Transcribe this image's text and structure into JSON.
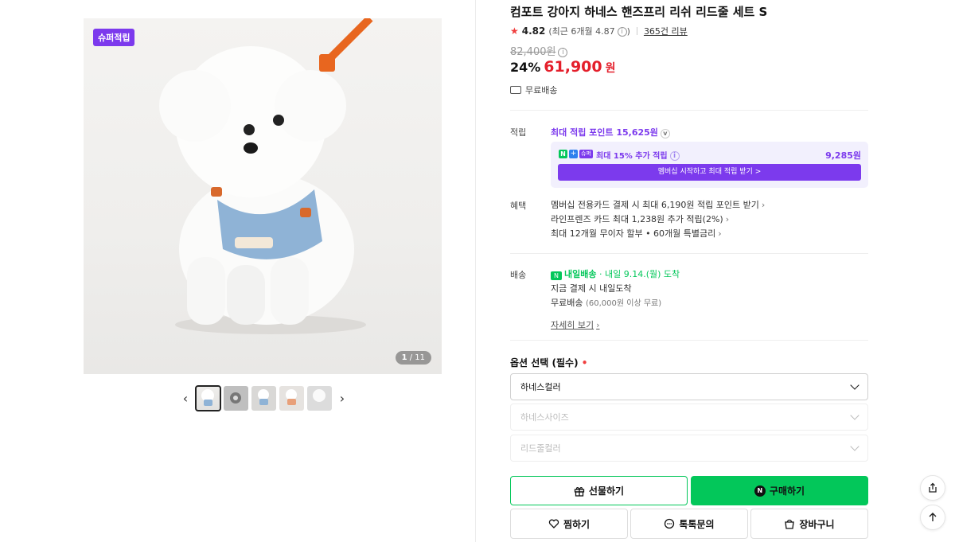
{
  "gallery": {
    "badge": "슈퍼적립",
    "counter_current": "1",
    "counter_total": "/ 11",
    "prev_label": "‹",
    "next_label": "›",
    "thumb_count": 5
  },
  "product": {
    "title": "컴포트 강아지 하네스 핸즈프리 리쉬 리드줄 세트 S",
    "rating_score": "4.82",
    "rating_recent": "(최근 6개월 4.87",
    "rating_recent_close": ")",
    "review_link": "365건 리뷰",
    "original_price": "82,400원",
    "discount": "24%",
    "sale_price": "61,900",
    "sale_unit": "원",
    "shipping": "무료배송"
  },
  "points": {
    "label": "적립",
    "max_text": "최대 적립 포인트 15,625원",
    "box_text": "최대 15% 추가 적립",
    "box_amount": "9,285원",
    "box_button": "멤버십 시작하고 최대 적립 받기 >",
    "badge_n": "N",
    "badge_plus": "+",
    "badge_super": "슈퍼"
  },
  "benefits": {
    "label": "혜택",
    "lines": [
      "멤버십 전용카드 결제 시 최대 6,190원 적립 포인트 받기",
      "라인프렌즈 카드 최대 1,238원 추가 적립(2%)",
      "최대 12개월 무이자 할부 • 60개월 특별금리"
    ]
  },
  "delivery": {
    "label": "배송",
    "badge": "N",
    "tomorrow": "내일배송",
    "eta": "· 내일 9.14.(월) 도착",
    "pay_note": "지금 결제 시 내일도착",
    "free": "무료배송",
    "free_note": "(60,000원 이상 무료)",
    "detail_link": "자세히 보기"
  },
  "options": {
    "title": "옵션 선택 (필수)",
    "required_mark": "•",
    "selects": [
      "하네스컬러",
      "하네스사이즈",
      "리드줄컬러"
    ]
  },
  "actions": {
    "gift": "선물하기",
    "buy": "구매하기",
    "buy_badge": "N",
    "wish": "찜하기",
    "talk": "톡톡문의",
    "cart": "장바구니"
  },
  "colors": {
    "accent_purple": "#7c3aed",
    "naver_green": "#03c75a",
    "price_red": "#e41f2b"
  }
}
